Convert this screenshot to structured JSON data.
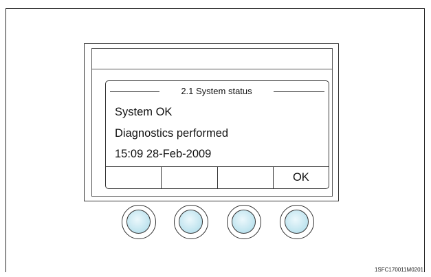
{
  "screen": {
    "title": "2.1 System status",
    "lines": [
      "System OK",
      "Diagnostics performed",
      "15:09 28-Feb-2009"
    ]
  },
  "softkeys": [
    "",
    "",
    "",
    "OK"
  ],
  "knobs": [
    {
      "icon": "rotary-knob-icon"
    },
    {
      "icon": "rotary-knob-icon"
    },
    {
      "icon": "rotary-knob-icon"
    },
    {
      "icon": "rotary-knob-icon"
    }
  ],
  "figure_ref": "1SFC170011M0201",
  "colors": {
    "knob_fill": "#c4e6f0",
    "outline": "#333333"
  }
}
